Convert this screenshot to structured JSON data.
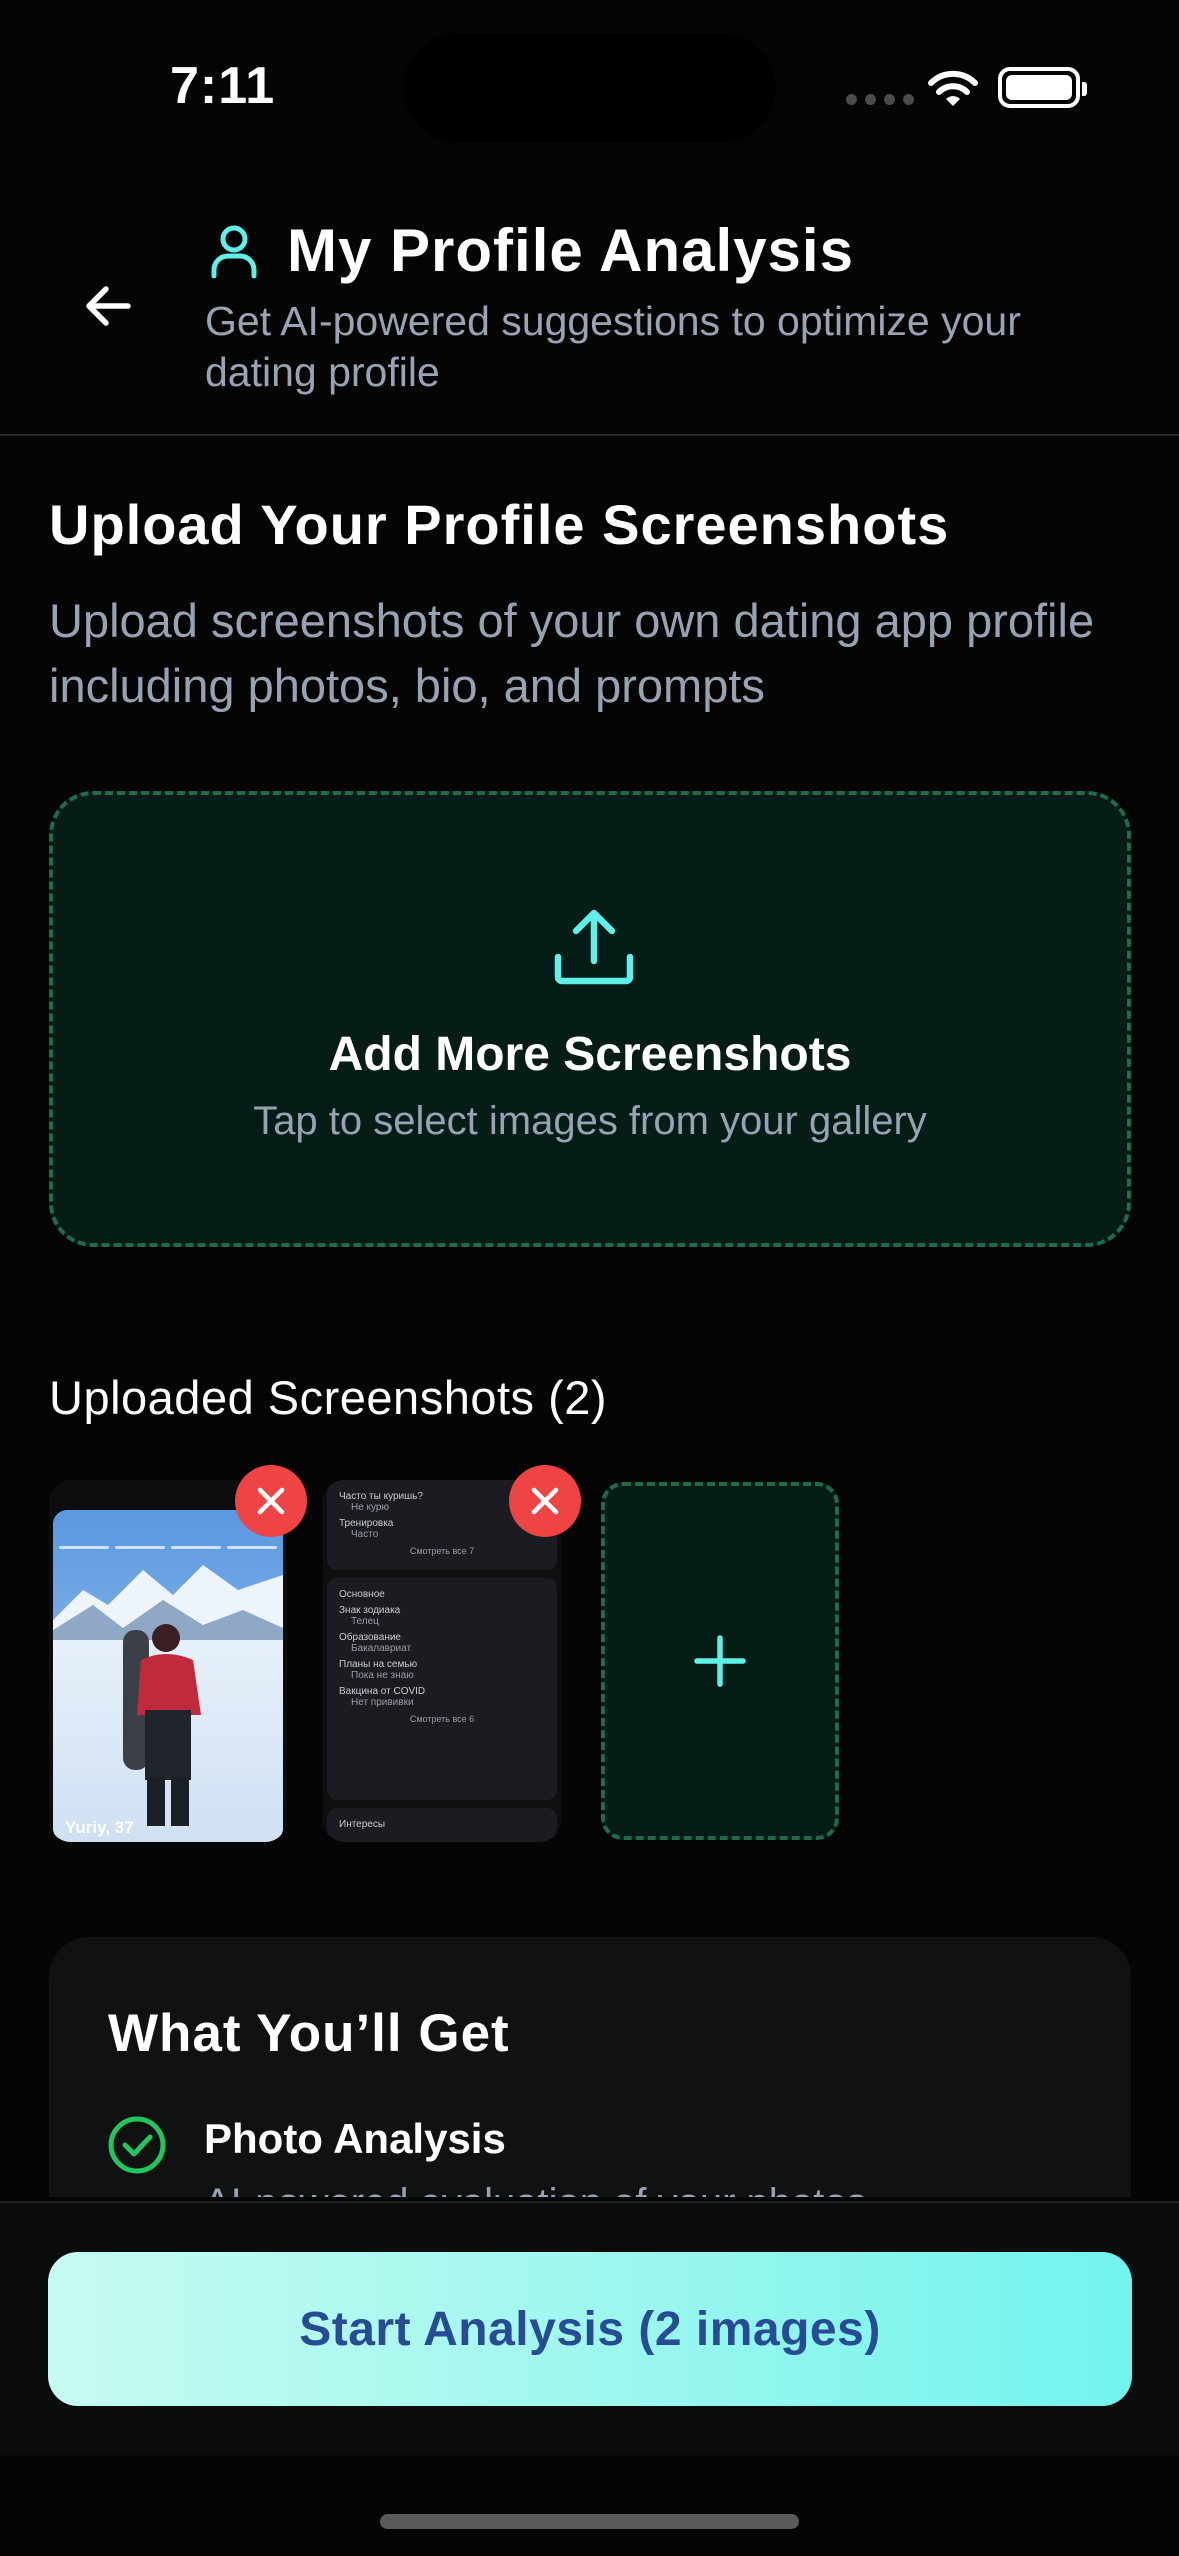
{
  "status_bar": {
    "time": "7:11"
  },
  "header": {
    "title": "My Profile Analysis",
    "subtitle": "Get AI-powered suggestions to optimize your dating profile",
    "icon": "user-icon",
    "back_icon": "arrow-left-icon"
  },
  "upload_section": {
    "title": "Upload Your Profile Screenshots",
    "description": "Upload screenshots of your own dating app profile including photos, bio, and prompts",
    "dropzone": {
      "icon": "upload-icon",
      "title": "Add More Screenshots",
      "subtitle": "Tap to select images from your gallery"
    }
  },
  "uploaded": {
    "title": "Uploaded Screenshots (2)",
    "screenshots": [
      {
        "name_label": "Yuriy, 37"
      },
      {
        "top_label": "Часто ты куришь?",
        "top_value": "Не курю",
        "training_label": "Тренировка",
        "training_value": "Часто",
        "see_all_1": "Смотреть все 7",
        "section": "Основное",
        "rows": [
          {
            "label": "Знак зодиака",
            "value": "Телец"
          },
          {
            "label": "Образование",
            "value": "Бакалавриат"
          },
          {
            "label": "Планы на семью",
            "value": "Пока не знаю"
          },
          {
            "label": "Вакцина от COVID",
            "value": "Нет прививки"
          }
        ],
        "see_all_2": "Смотреть все 6",
        "interests": "Интересы"
      }
    ],
    "add_icon": "plus-icon",
    "remove_icon": "close-icon"
  },
  "features": {
    "title": "What You’ll Get",
    "items": [
      {
        "icon": "check-circle-icon",
        "title": "Photo Analysis",
        "description": "AI-powered evaluation of your photos"
      }
    ]
  },
  "cta": {
    "label": "Start Analysis (2 images)"
  },
  "colors": {
    "accent": "#5ff0ea",
    "danger": "#ef4444",
    "success": "#22c55e",
    "cta_text": "#274c93"
  }
}
